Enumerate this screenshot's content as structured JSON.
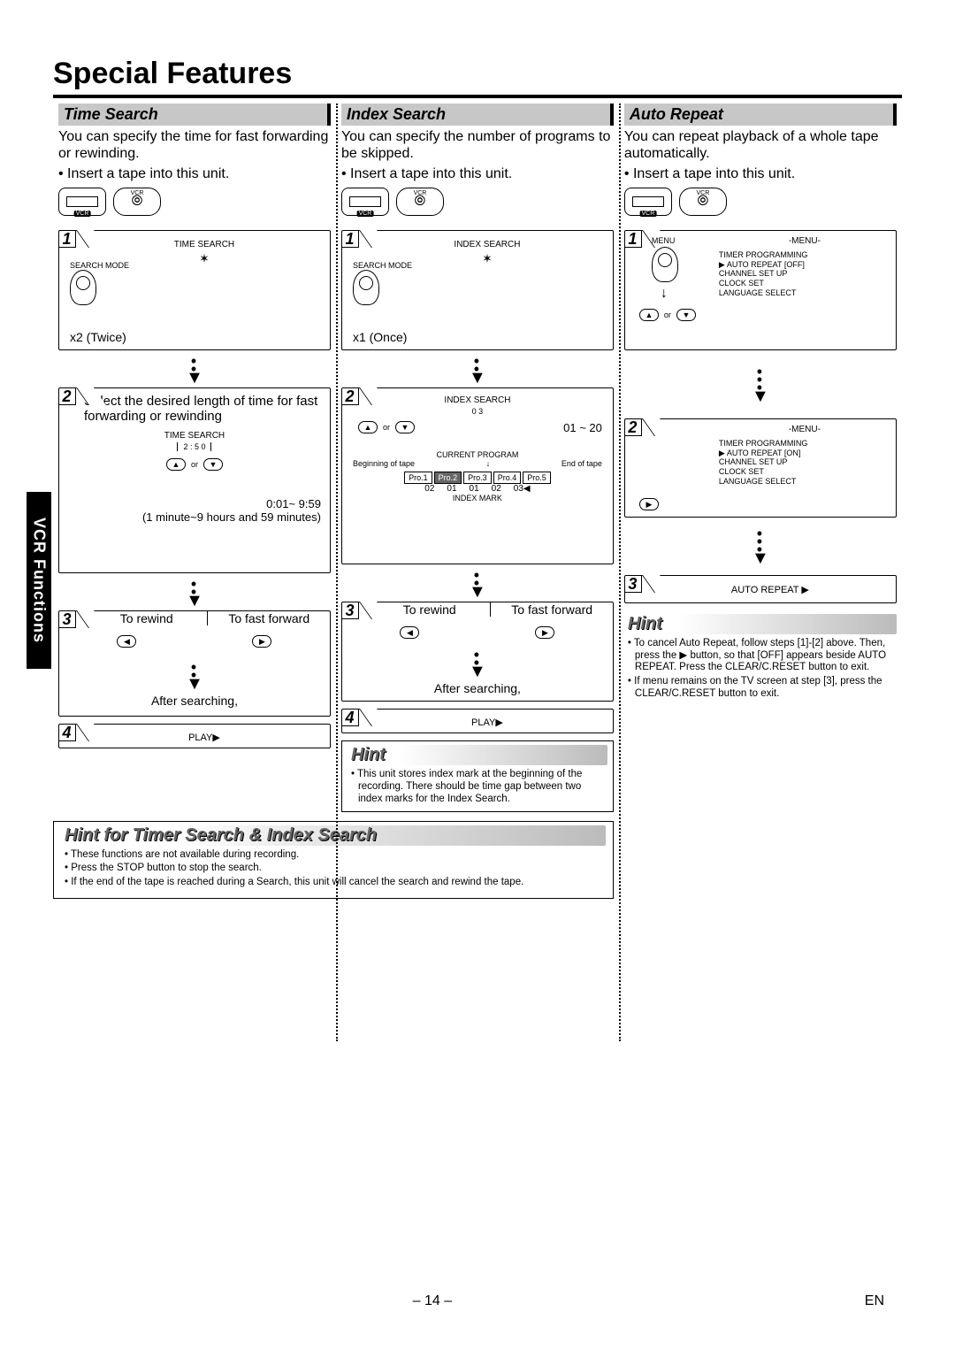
{
  "page": {
    "title": "Special Features",
    "sideTab": "VCR Functions",
    "pageNumber": "– 14 –",
    "langCode": "EN"
  },
  "col1": {
    "header": "Time Search",
    "intro": "You can specify the time for fast forwarding or rewinding.",
    "bullet": "• Insert a tape into this unit.",
    "step1": {
      "diagLabel": "TIME SEARCH",
      "btnLabel": "SEARCH MODE",
      "caption": "x2 (Twice)"
    },
    "step2": {
      "text": "Select the desired length of time for fast forwarding or rewinding",
      "diagLabel": "TIME SEARCH",
      "diagValue": "2 : 5 0",
      "or": "or",
      "range": "0:01~ 9:59",
      "rangeNote": "(1 minute~9 hours and 59 minutes)"
    },
    "step3": {
      "left": "To rewind",
      "right": "To fast forward",
      "after": "After searching,"
    },
    "step4": {
      "label": "PLAY▶"
    }
  },
  "col2": {
    "header": "Index Search",
    "intro": "You can specify the number of programs to be skipped.",
    "bullet": "• Insert a tape into this unit.",
    "step1": {
      "diagLabel": "INDEX SEARCH",
      "btnLabel": "SEARCH MODE",
      "caption": "x1 (Once)"
    },
    "step2": {
      "diagLabel": "INDEX SEARCH",
      "diagValue": "0 3",
      "or": "or",
      "range": "01 ~ 20",
      "currentProgram": "CURRENT PROGRAM",
      "beginLabel": "Beginning of tape",
      "endLabel": "End of tape",
      "progs": [
        "Pro.1",
        "Pro.2",
        "Pro.3",
        "Pro.4",
        "Pro.5"
      ],
      "nums": [
        "02",
        "01",
        "01",
        "02",
        "03◀"
      ],
      "indexMark": "INDEX MARK"
    },
    "step3": {
      "left": "To rewind",
      "right": "To fast forward",
      "after": "After searching,"
    },
    "step4": {
      "label": "PLAY▶"
    },
    "hint": {
      "title": "Hint",
      "items": [
        "This unit stores index mark at the beginning of the recording. There should be time gap between two index marks for the Index Search."
      ]
    }
  },
  "col3": {
    "header": "Auto Repeat",
    "intro": "You can repeat playback of a whole tape automatically.",
    "bullet": "• Insert a tape into this unit.",
    "step1": {
      "btnLabel": "MENU",
      "menuHeader": "-MENU-",
      "menuItems": [
        "TIMER PROGRAMMING",
        "▶ AUTO REPEAT  [OFF]",
        "CHANNEL SET UP",
        "CLOCK SET",
        "LANGUAGE SELECT"
      ],
      "or": "or"
    },
    "step2": {
      "menuHeader": "-MENU-",
      "menuItems": [
        "TIMER PROGRAMMING",
        "▶ AUTO REPEAT  [ON]",
        "CHANNEL SET UP",
        "CLOCK SET",
        "LANGUAGE SELECT"
      ]
    },
    "step3": {
      "label": "AUTO REPEAT ▶"
    },
    "hint": {
      "title": "Hint",
      "items": [
        "To cancel Auto Repeat, follow steps [1]-[2] above. Then, press the ▶ button, so that [OFF] appears beside AUTO REPEAT.  Press the CLEAR/C.RESET button to exit.",
        "If menu remains on the TV screen at step [3], press the CLEAR/C.RESET button to exit."
      ]
    }
  },
  "bottomHint": {
    "title": "Hint for Timer Search & Index Search",
    "items": [
      "These functions are not available during recording.",
      "Press the STOP button to stop the search.",
      "If the end of the tape is reached during a Search, this unit will cancel the search and rewind the tape."
    ]
  }
}
